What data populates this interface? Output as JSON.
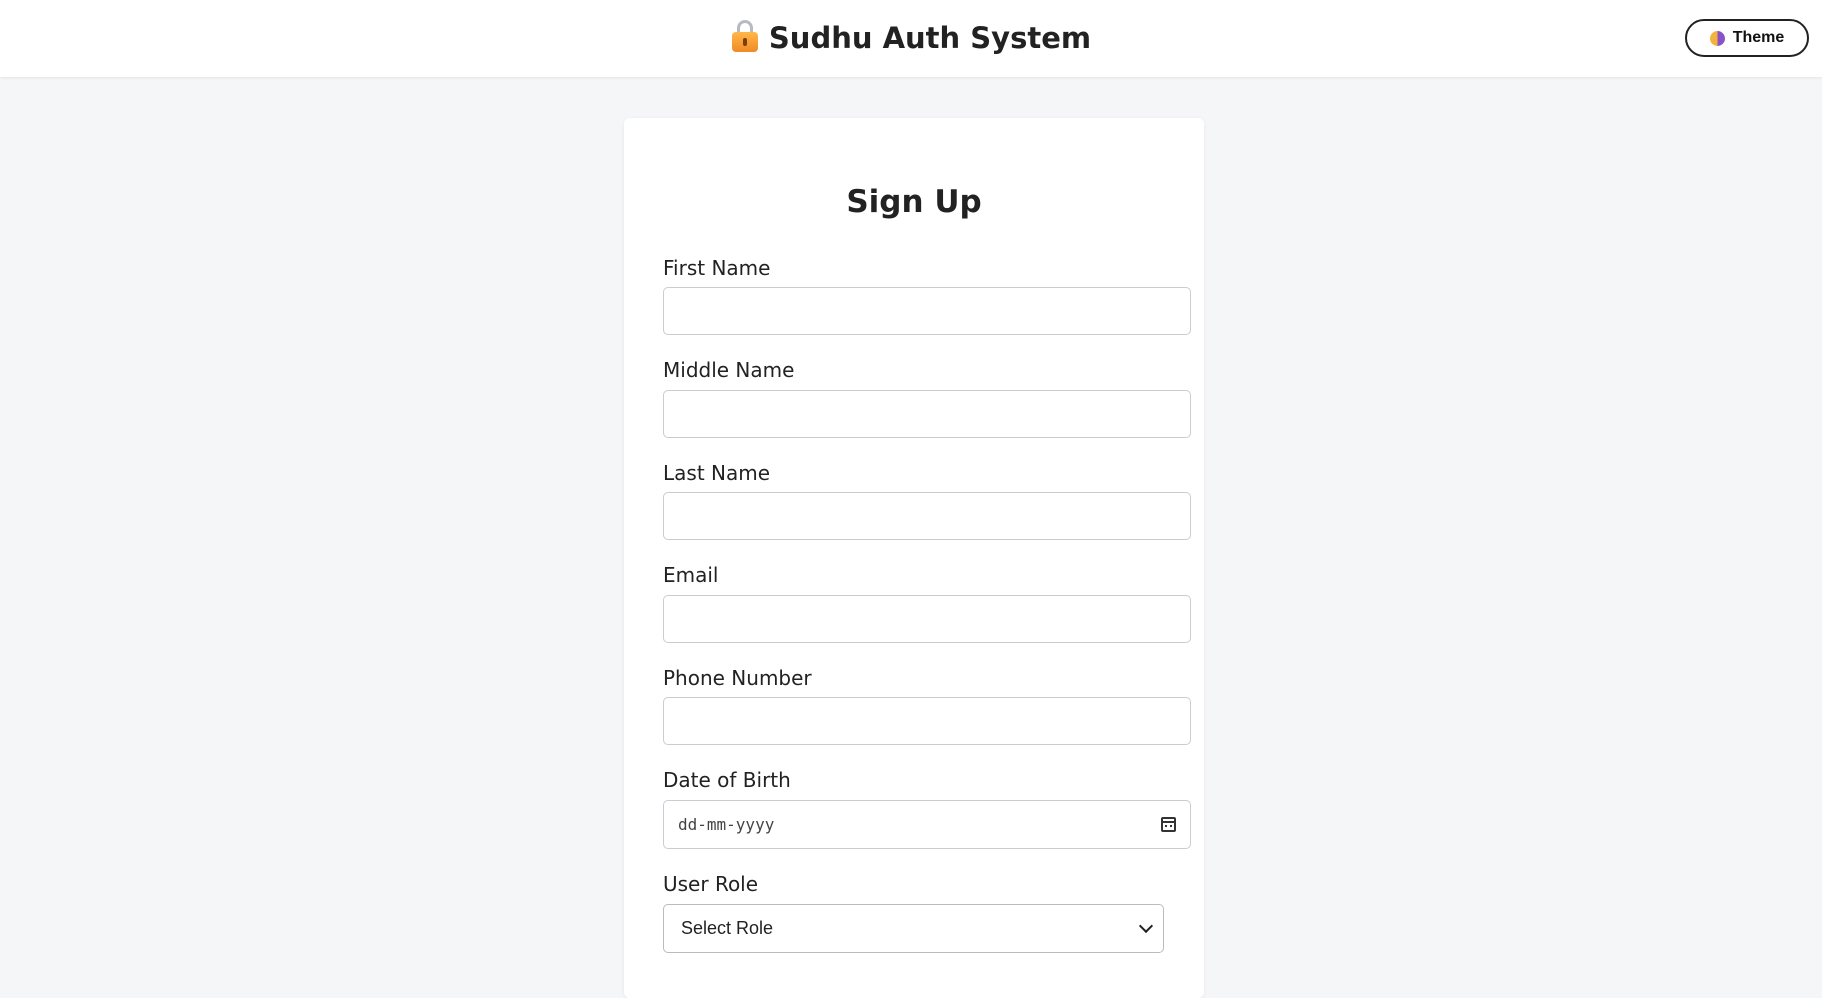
{
  "header": {
    "lock_icon": "lock-icon",
    "title": "Sudhu Auth System",
    "theme_button_label": "Theme",
    "theme_icon": "theme-half-circle-icon"
  },
  "form": {
    "title": "Sign Up",
    "fields": {
      "first_name": {
        "label": "First Name",
        "value": ""
      },
      "middle_name": {
        "label": "Middle Name",
        "value": ""
      },
      "last_name": {
        "label": "Last Name",
        "value": ""
      },
      "email": {
        "label": "Email",
        "value": ""
      },
      "phone": {
        "label": "Phone Number",
        "value": ""
      },
      "dob": {
        "label": "Date of Birth",
        "placeholder": "dd-mm-yyyy",
        "icon": "calendar-icon"
      },
      "role": {
        "label": "User Role",
        "selected": "Select Role"
      }
    }
  },
  "colors": {
    "page_background": "#f5f6f8",
    "card_background": "#ffffff",
    "input_border": "#c9ccd1",
    "text": "#222222"
  }
}
